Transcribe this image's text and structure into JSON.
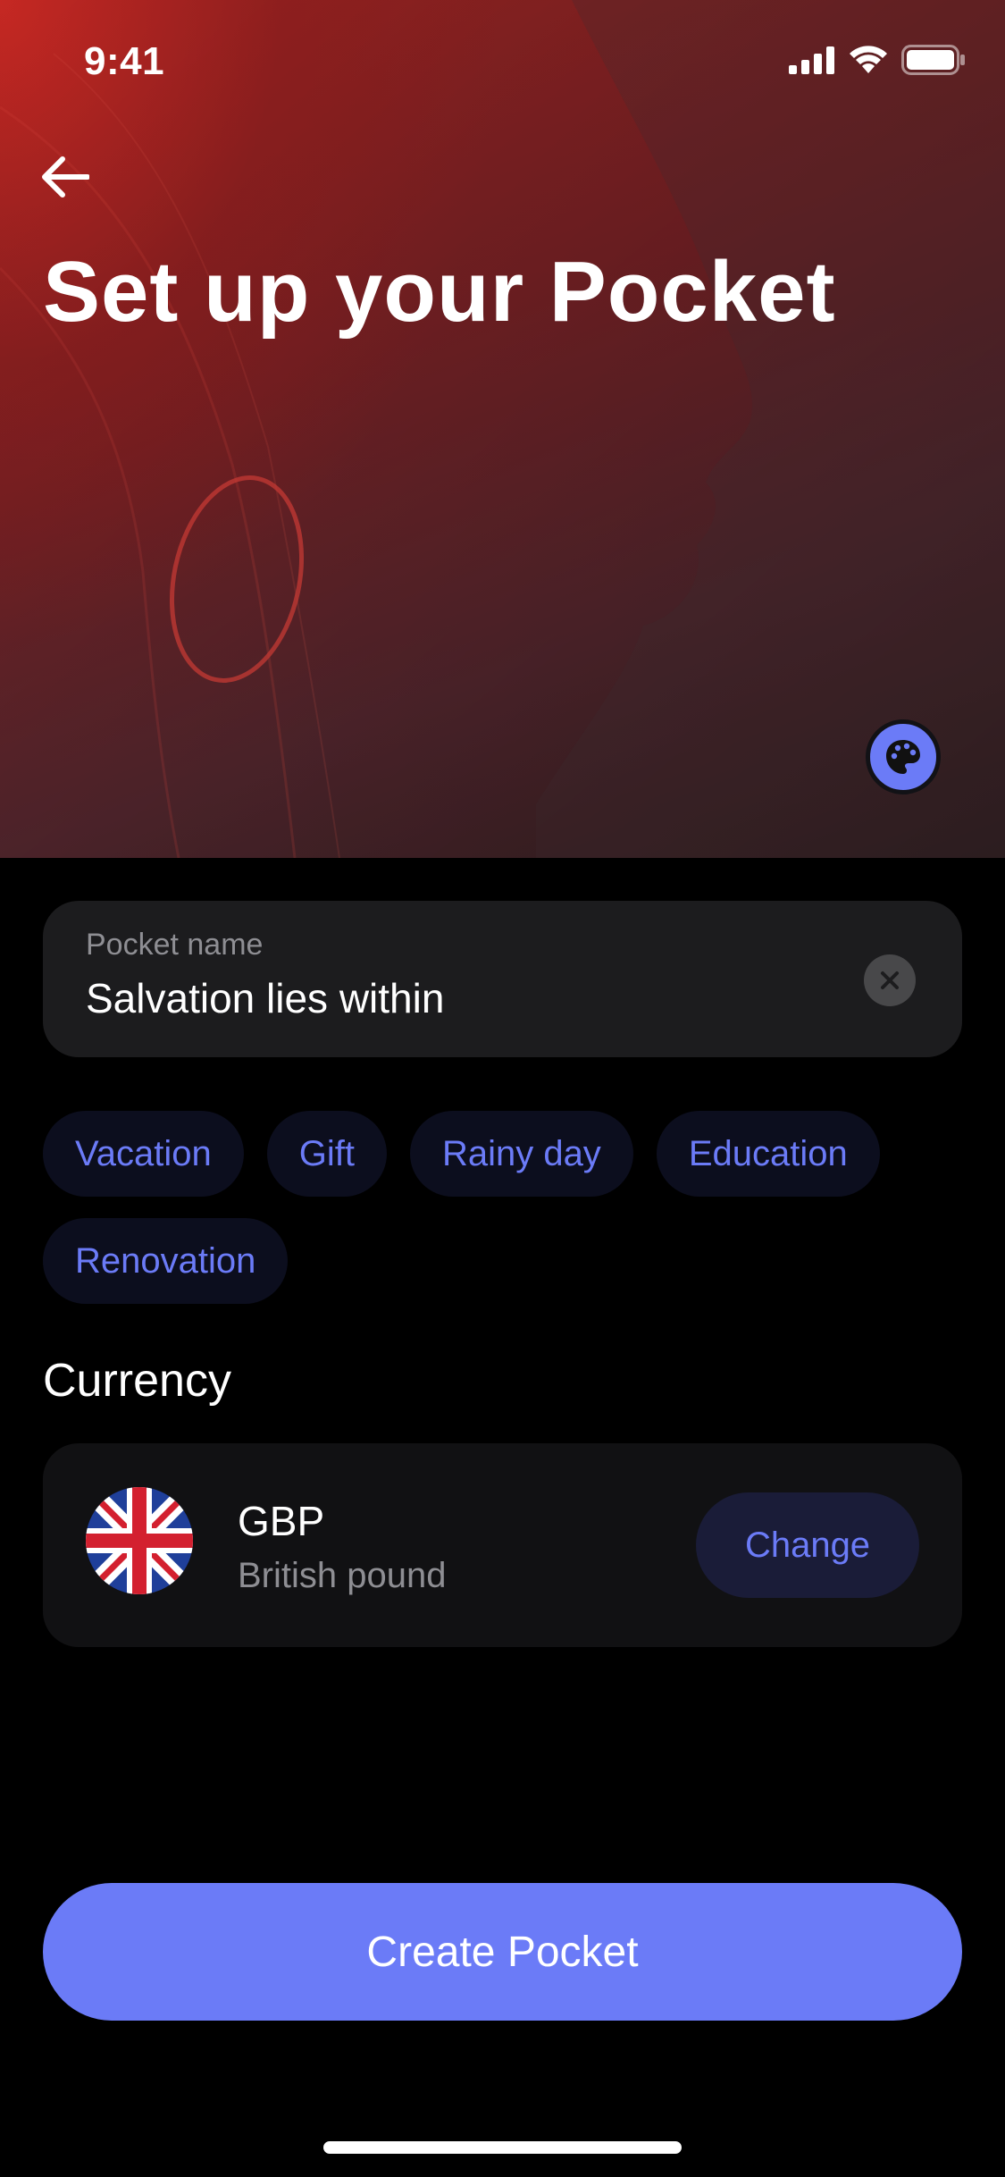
{
  "status_bar": {
    "time": "9:41"
  },
  "header": {
    "title": "Set up your Pocket"
  },
  "name_field": {
    "label": "Pocket name",
    "value": "Salvation lies within"
  },
  "suggestions": [
    {
      "label": "Vacation"
    },
    {
      "label": "Gift"
    },
    {
      "label": "Rainy day"
    },
    {
      "label": "Education"
    },
    {
      "label": "Renovation"
    }
  ],
  "currency": {
    "section_title": "Currency",
    "code": "GBP",
    "name": "British pound",
    "change_label": "Change"
  },
  "actions": {
    "create_label": "Create Pocket"
  },
  "colors": {
    "accent": "#6b7bf7",
    "background": "#000000",
    "card": "#1c1c1e",
    "hero": "#8a2424"
  },
  "icons": [
    "back-arrow-icon",
    "palette-icon",
    "clear-icon",
    "uk-flag-icon",
    "signal-icon",
    "wifi-icon",
    "battery-icon"
  ]
}
